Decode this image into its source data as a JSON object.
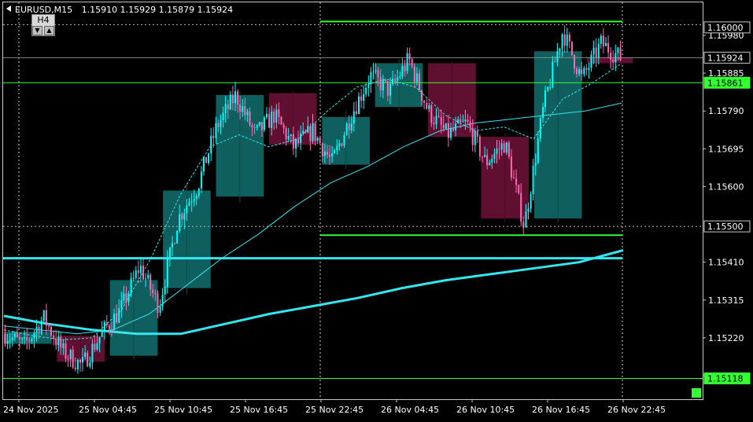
{
  "header": {
    "symbol": "EURUSD,M15",
    "ohlc": "1.15910 1.15929 1.15879 1.15924"
  },
  "timeframe_switch": {
    "label": "H4",
    "down_glyph": "▼",
    "up_glyph": "▲"
  },
  "colors": {
    "background": "#000000",
    "bull_candle": "#00ffff",
    "bear_candle": "#ff69b4",
    "bull_box": "#0f5f5f",
    "bear_box": "#5f0f30",
    "level_line": "#33ff33",
    "ma_line": "#33e6f0",
    "current_price_line": "#888888"
  },
  "chart_data": {
    "type": "candlestick",
    "symbol": "EURUSD",
    "timeframe": "M15",
    "y_ticks": [
      "1.15980",
      "1.15885",
      "1.15790",
      "1.15695",
      "1.15600",
      "1.15410",
      "1.15315",
      "1.15220",
      "1.15125"
    ],
    "x_ticks": [
      "24 Nov 2025",
      "25 Nov 04:45",
      "25 Nov 10:45",
      "25 Nov 16:45",
      "25 Nov 22:45",
      "26 Nov 04:45",
      "26 Nov 10:45",
      "26 Nov 16:45",
      "26 Nov 22:45"
    ],
    "price_labels": [
      {
        "value": "1.16000",
        "type": "level"
      },
      {
        "value": "1.15924",
        "type": "current"
      },
      {
        "value": "1.15861",
        "type": "highlight"
      },
      {
        "value": "1.15500",
        "type": "level"
      },
      {
        "value": "1.15118",
        "type": "highlight"
      }
    ],
    "horizontal_levels": [
      1.16007,
      1.15861,
      1.15478,
      1.1542,
      1.15118
    ],
    "h4_candles": [
      {
        "open": 1.15205,
        "close": 1.15235,
        "high": 1.15245,
        "low": 1.15195
      },
      {
        "open": 1.15225,
        "close": 1.1516,
        "high": 1.1523,
        "low": 1.15145
      },
      {
        "open": 1.15175,
        "close": 1.15365,
        "high": 1.1538,
        "low": 1.15165
      },
      {
        "open": 1.15345,
        "close": 1.1559,
        "high": 1.15605,
        "low": 1.1533
      },
      {
        "open": 1.15575,
        "close": 1.1583,
        "high": 1.1584,
        "low": 1.1556
      },
      {
        "open": 1.15835,
        "close": 1.15705,
        "high": 1.1584,
        "low": 1.1569
      },
      {
        "open": 1.15655,
        "close": 1.15775,
        "high": 1.1579,
        "low": 1.15645
      },
      {
        "open": 1.158,
        "close": 1.1591,
        "high": 1.1592,
        "low": 1.1579
      },
      {
        "open": 1.1591,
        "close": 1.15725,
        "high": 1.15915,
        "low": 1.15715
      },
      {
        "open": 1.15725,
        "close": 1.1552,
        "high": 1.15735,
        "low": 1.1551
      },
      {
        "open": 1.1552,
        "close": 1.1594,
        "high": 1.1595,
        "low": 1.1551
      },
      {
        "open": 1.15924,
        "close": 1.1591,
        "high": 1.15935,
        "low": 1.159
      }
    ],
    "waypoints": [
      1.1523,
      1.152,
      1.1527,
      1.15185,
      1.1515,
      1.1523,
      1.1529,
      1.154,
      1.153,
      1.1552,
      1.156,
      1.1575,
      1.1583,
      1.1573,
      1.1578,
      1.157,
      1.1574,
      1.1566,
      1.1578,
      1.1588,
      1.1584,
      1.1592,
      1.1579,
      1.1573,
      1.1576,
      1.1566,
      1.1571,
      1.155,
      1.158,
      1.1599,
      1.1587,
      1.1596,
      1.15924
    ],
    "ma_fast_points": [
      1.1524,
      1.15225,
      1.15215,
      1.1522,
      1.1529,
      1.1542,
      1.1558,
      1.157,
      1.1573,
      1.157,
      1.1572,
      1.1579,
      1.1585,
      1.1587,
      1.1585,
      1.1578,
      1.1574,
      1.1575,
      1.1572,
      1.1582,
      1.1586,
      1.1591
    ],
    "ma_mid_points": [
      1.1525,
      1.1524,
      1.1523,
      1.1524,
      1.1528,
      1.1535,
      1.1542,
      1.1548,
      1.1555,
      1.1561,
      1.1565,
      1.157,
      1.1574,
      1.1576,
      1.1577,
      1.1578,
      1.1579,
      1.1581
    ],
    "ma_slow_points": [
      1.15275,
      1.15255,
      1.1524,
      1.1523,
      1.1523,
      1.15255,
      1.1528,
      1.153,
      1.1532,
      1.15345,
      1.15365,
      1.1538,
      1.15395,
      1.1541,
      1.1544
    ]
  }
}
